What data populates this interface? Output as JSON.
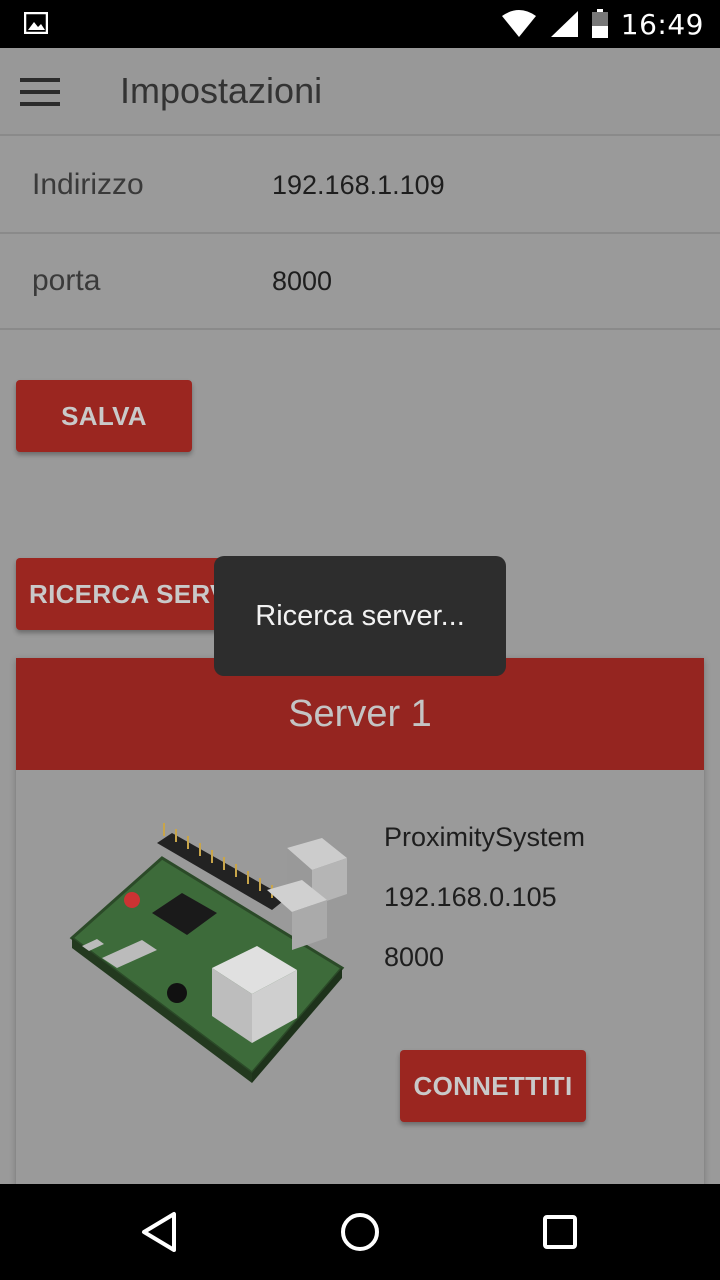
{
  "status_bar": {
    "time": "16:49",
    "icons": [
      "image-notification-icon",
      "wifi-icon",
      "cell-signal-icon",
      "battery-icon"
    ]
  },
  "app_bar": {
    "title": "Impostazioni",
    "menu_icon": "hamburger-menu-icon"
  },
  "settings": {
    "address_label": "Indirizzo",
    "address_value": "192.168.1.109",
    "port_label": "porta",
    "port_value": "8000"
  },
  "buttons": {
    "save": "SALVA",
    "search": "RICERCA SERVER"
  },
  "toast": {
    "text": "Ricerca server..."
  },
  "server_card": {
    "title": "Server 1",
    "name": "ProximitySystem",
    "ip": "192.168.0.105",
    "port": "8000",
    "connect": "CONNETTITI",
    "image": "raspberry-pi-board"
  },
  "nav_bar": {
    "icons": [
      "back-icon",
      "home-icon",
      "recents-icon"
    ]
  },
  "colors": {
    "accent": "#9b2620",
    "card_header": "#952520",
    "scrim_background": "#9a9a9a",
    "toast": "#2d2d2d"
  }
}
